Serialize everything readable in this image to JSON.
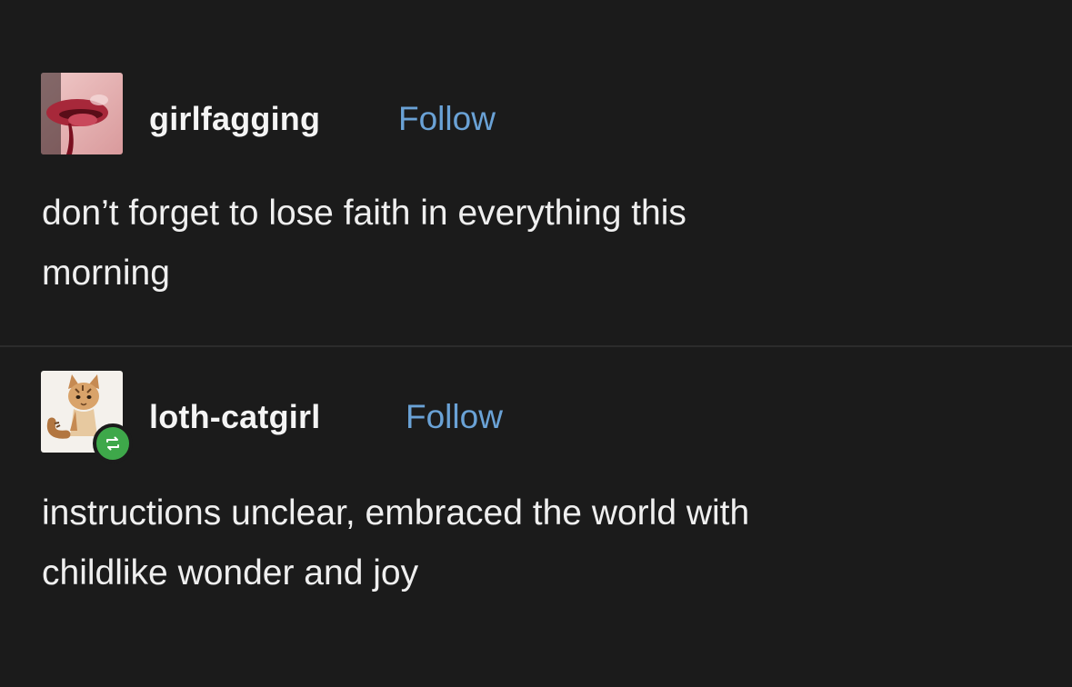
{
  "posts": [
    {
      "username": "girlfagging",
      "follow_label": "Follow",
      "lines": [
        "don’t forget to lose faith in everything this",
        "morning"
      ]
    },
    {
      "username": "loth-catgirl",
      "follow_label": "Follow",
      "lines": [
        "instructions unclear, embraced the world with",
        "childlike wonder and joy"
      ],
      "badge_icon": "reblog-icon"
    }
  ],
  "colors": {
    "background": "#1b1b1b",
    "text": "#efefef",
    "follow": "#6aa2d6",
    "reblog_badge": "#3ea84a"
  }
}
